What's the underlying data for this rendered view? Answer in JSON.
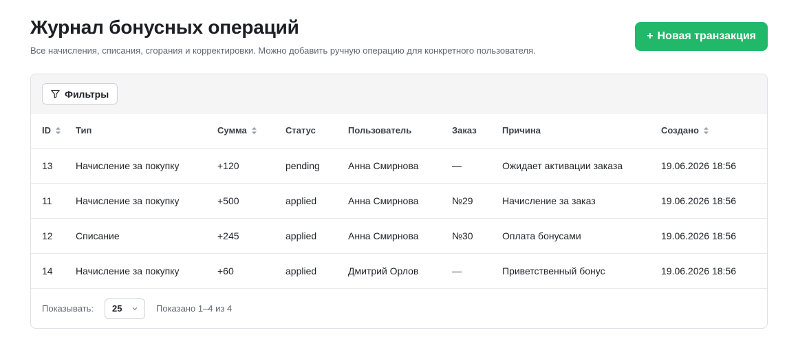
{
  "header": {
    "title": "Журнал бонусных операций",
    "subtitle": "Все начисления, списания, сгорания и корректировки. Можно добавить ручную операцию для конкретного пользователя.",
    "new_button_plus": "+",
    "new_button_label": "Новая транзакция"
  },
  "toolbar": {
    "filter_label": "Фильтры",
    "filter_icon": "filter-icon"
  },
  "table": {
    "columns": [
      {
        "label": "ID",
        "sortable": true
      },
      {
        "label": "Тип",
        "sortable": false
      },
      {
        "label": "Сумма",
        "sortable": true
      },
      {
        "label": "Статус",
        "sortable": false
      },
      {
        "label": "Пользователь",
        "sortable": false
      },
      {
        "label": "Заказ",
        "sortable": false
      },
      {
        "label": "Причина",
        "sortable": false
      },
      {
        "label": "Создано",
        "sortable": true
      }
    ],
    "rows": [
      {
        "id": "13",
        "type": "Начисление за покупку",
        "amount": "+120",
        "status": "pending",
        "user": "Анна Смирнова",
        "order": "—",
        "reason": "Ожидает активации заказа",
        "created": "19.06.2026 18:56"
      },
      {
        "id": "11",
        "type": "Начисление за покупку",
        "amount": "+500",
        "status": "applied",
        "user": "Анна Смирнова",
        "order": "№29",
        "reason": "Начисление за заказ",
        "created": "19.06.2026 18:56"
      },
      {
        "id": "12",
        "type": "Списание",
        "amount": "+245",
        "status": "applied",
        "user": "Анна Смирнова",
        "order": "№30",
        "reason": "Оплата бонусами",
        "created": "19.06.2026 18:56"
      },
      {
        "id": "14",
        "type": "Начисление за покупку",
        "amount": "+60",
        "status": "applied",
        "user": "Дмитрий Орлов",
        "order": "—",
        "reason": "Приветственный бонус",
        "created": "19.06.2026 18:56"
      }
    ]
  },
  "footer": {
    "page_size_label": "Показывать:",
    "page_size_value": "25",
    "results_text": "Показано 1–4 из 4"
  },
  "colors": {
    "accent": "#22b86a",
    "toolbar_bg": "#f5f5f6",
    "border": "#dde1e6"
  }
}
